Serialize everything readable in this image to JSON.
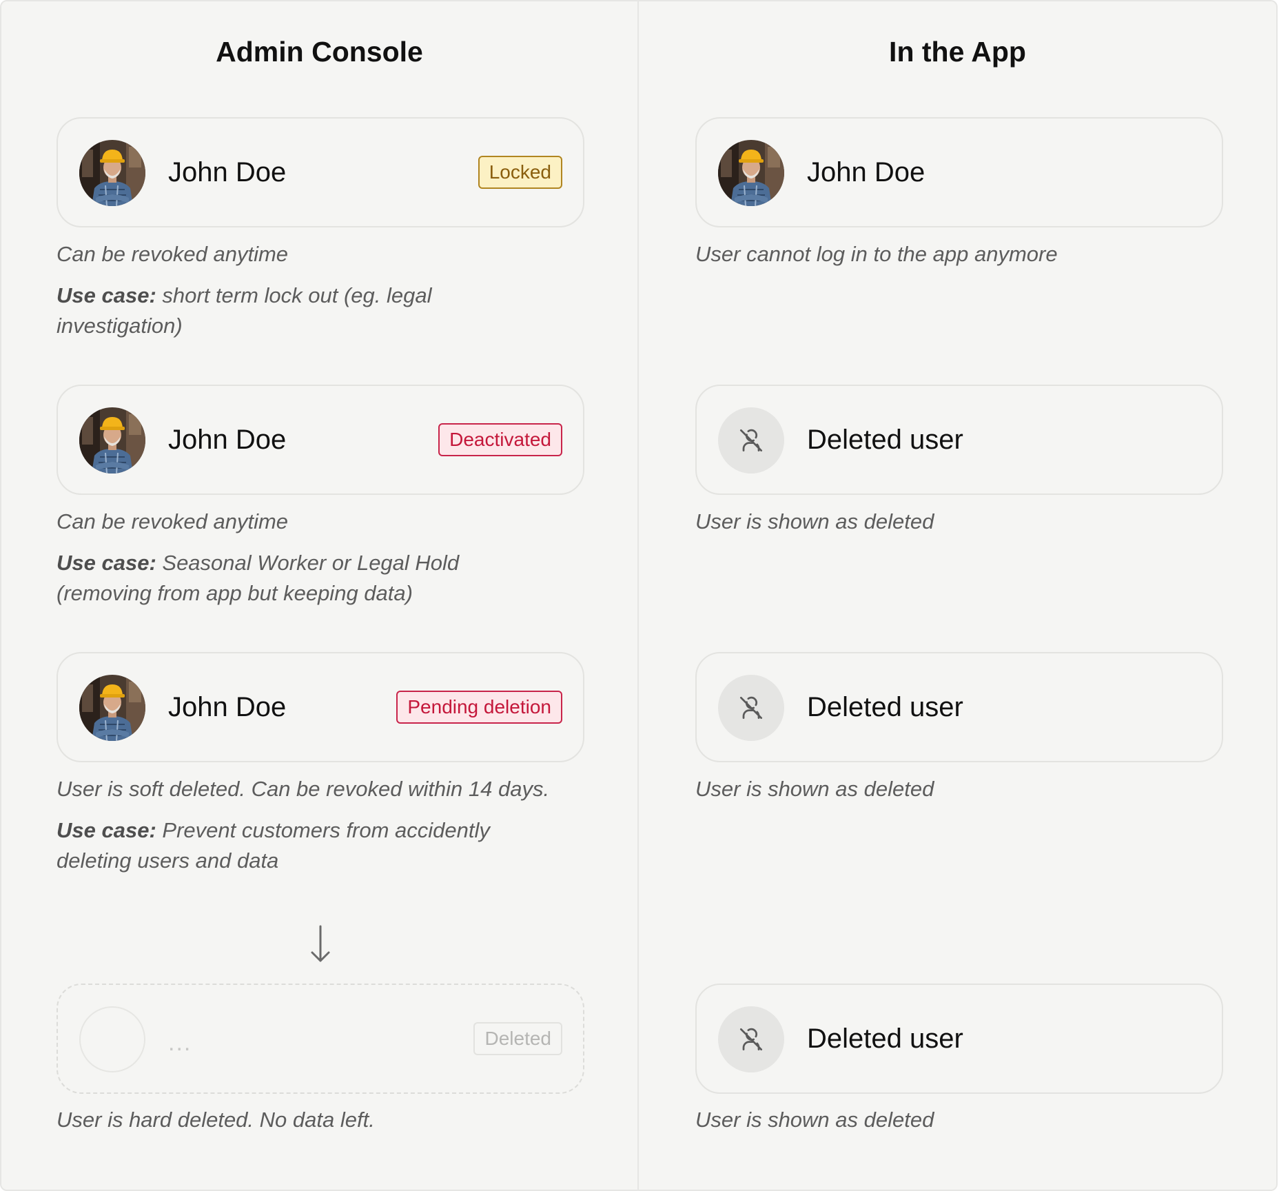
{
  "admin": {
    "title": "Admin Console",
    "cards": [
      {
        "name": "John Doe",
        "badge": "Locked",
        "badge_color": "#8a5e0d",
        "note": "Can be revoked anytime",
        "use_case_label": "Use case:",
        "use_case": " short term lock out (eg. legal investigation)"
      },
      {
        "name": "John Doe",
        "badge": "Deactivated",
        "badge_color": "#c4173a",
        "note": "Can be revoked anytime",
        "use_case_label": "Use case:",
        "use_case": " Seasonal Worker or Legal Hold (removing from app but keeping data)"
      },
      {
        "name": "John Doe",
        "badge": "Pending deletion",
        "badge_color": "#c4173a",
        "note": "User is soft deleted. Can be revoked within 14 days.",
        "use_case_label": "Use case:",
        "use_case": " Prevent customers from accidently deleting users and data"
      },
      {
        "name": "...",
        "badge": "Deleted",
        "badge_color": "#b5b5b3",
        "note": "User is hard deleted. No data left."
      }
    ]
  },
  "app": {
    "title": "In the App",
    "cards": [
      {
        "name": "John Doe",
        "note": "User cannot log in to the app anymore"
      },
      {
        "name": "Deleted user",
        "icon": "user-off-icon",
        "note": "User is shown as deleted"
      },
      {
        "name": "Deleted user",
        "icon": "user-off-icon",
        "note": "User is shown as deleted"
      },
      {
        "name": "Deleted user",
        "icon": "user-off-icon",
        "note": "User is shown as deleted"
      }
    ]
  }
}
